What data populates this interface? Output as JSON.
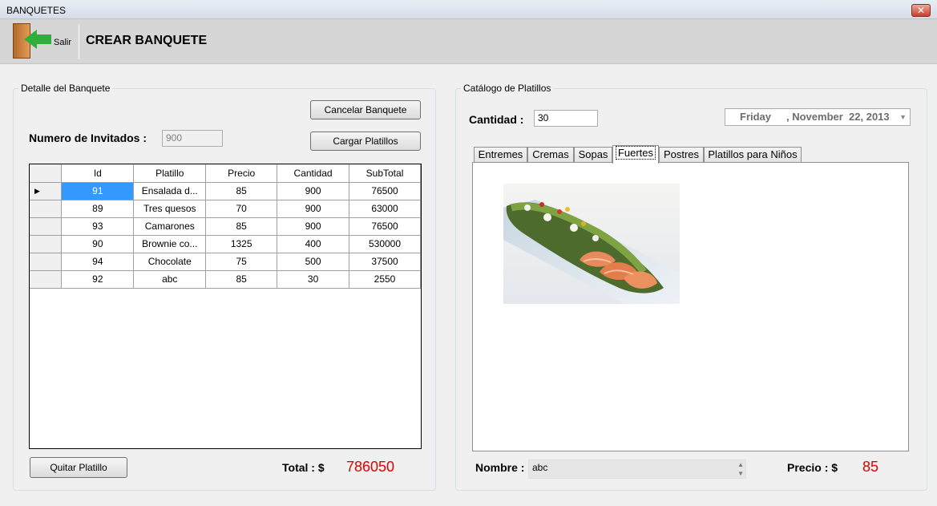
{
  "window": {
    "title": "BANQUETES",
    "close_glyph": "✕"
  },
  "toolbar": {
    "exit_label": "Salir",
    "exit_icon": "exit-door-icon",
    "page_title": "CREAR BANQUETE"
  },
  "detail": {
    "legend": "Detalle del Banquete",
    "cancel_button": "Cancelar Banquete",
    "load_button": "Cargar Platillos",
    "guests_label": "Numero de Invitados :",
    "guests_value": "900",
    "remove_button": "Quitar Platillo",
    "total_label": "Total : $",
    "total_value": "786050",
    "grid": {
      "columns": [
        "Id",
        "Platillo",
        "Precio",
        "Cantidad",
        "SubTotal"
      ],
      "rows": [
        [
          "91",
          "Ensalada d...",
          "85",
          "900",
          "76500"
        ],
        [
          "89",
          "Tres quesos",
          "70",
          "900",
          "63000"
        ],
        [
          "93",
          "Camarones",
          "85",
          "900",
          "76500"
        ],
        [
          "90",
          "Brownie co...",
          "1325",
          "400",
          "530000"
        ],
        [
          "94",
          "Chocolate",
          "75",
          "500",
          "37500"
        ],
        [
          "92",
          "abc",
          "85",
          "30",
          "2550"
        ]
      ],
      "current_row_marker": "▶"
    }
  },
  "catalog": {
    "legend": "Catálogo de Platillos",
    "quantity_label": "Cantidad :",
    "quantity_value": "30",
    "date_day": "Friday",
    "date_rest": ", November  22, 2013",
    "tabs": [
      "Entremes",
      "Cremas",
      "Sopas",
      "Fuertes",
      "Postres",
      "Platillos para Niños"
    ],
    "active_tab": "Fuertes",
    "name_label": "Nombre :",
    "name_value": "abc",
    "price_label": "Precio : $",
    "price_value": "85"
  },
  "colors": {
    "accent_red": "#e00000",
    "selection": "#3399ff"
  }
}
